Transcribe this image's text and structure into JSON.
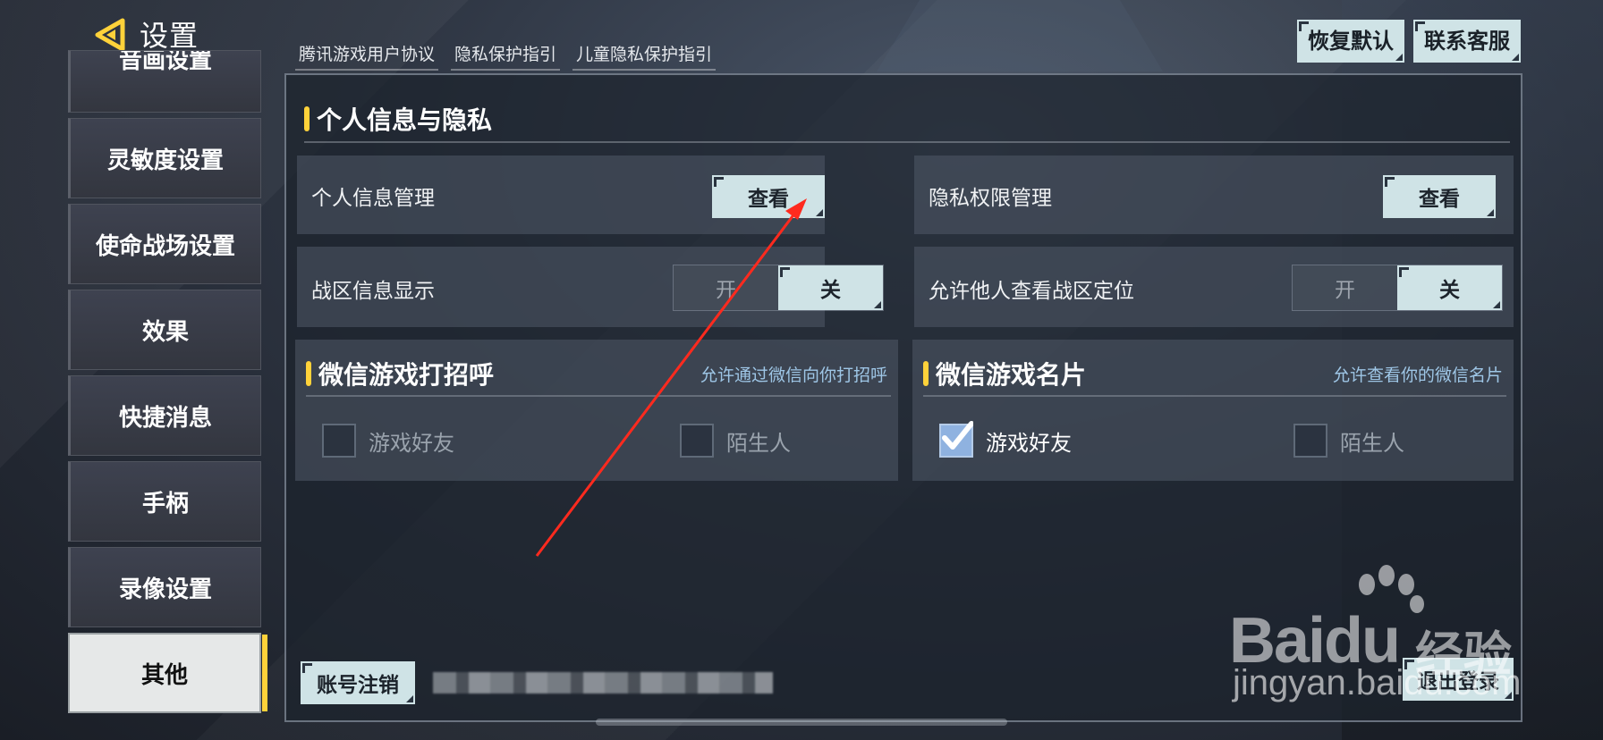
{
  "header": {
    "title": "设置",
    "links": [
      "腾讯游戏用户协议",
      "隐私保护指引",
      "儿童隐私保护指引"
    ],
    "restore_default": "恢复默认",
    "contact_support": "联系客服"
  },
  "sidebar": {
    "items": [
      {
        "label": "音画设置"
      },
      {
        "label": "灵敏度设置"
      },
      {
        "label": "使命战场设置"
      },
      {
        "label": "效果"
      },
      {
        "label": "快捷消息"
      },
      {
        "label": "手柄"
      },
      {
        "label": "录像设置"
      },
      {
        "label": "其他",
        "active": true
      }
    ]
  },
  "main": {
    "section_title": "个人信息与隐私",
    "personal_info": {
      "label": "个人信息管理",
      "button": "查看"
    },
    "privacy_perm": {
      "label": "隐私权限管理",
      "button": "查看"
    },
    "zone_info": {
      "label": "战区信息显示",
      "on": "开",
      "off": "关",
      "selected": "关"
    },
    "allow_view_zone": {
      "label": "允许他人查看战区定位",
      "on": "开",
      "off": "关",
      "selected": "关"
    },
    "wechat_greet": {
      "title": "微信游戏打招呼",
      "hint": "允许通过微信向你打招呼",
      "options": [
        {
          "label": "游戏好友",
          "checked": false
        },
        {
          "label": "陌生人",
          "checked": false
        }
      ]
    },
    "wechat_card": {
      "title": "微信游戏名片",
      "hint": "允许查看你的微信名片",
      "options": [
        {
          "label": "游戏好友",
          "checked": true
        },
        {
          "label": "陌生人",
          "checked": false
        }
      ]
    }
  },
  "footer": {
    "cancel_account": "账号注销",
    "logout": "退出登录"
  },
  "watermark": {
    "brand": "Bai",
    "brand_du": "du",
    "brand_cn": "经验",
    "url": "jingyan.baidu.com"
  },
  "colors": {
    "accent": "#ffd23a",
    "button_bg": "#cfe3e6",
    "annotation_arrow": "#ff2a1e"
  }
}
